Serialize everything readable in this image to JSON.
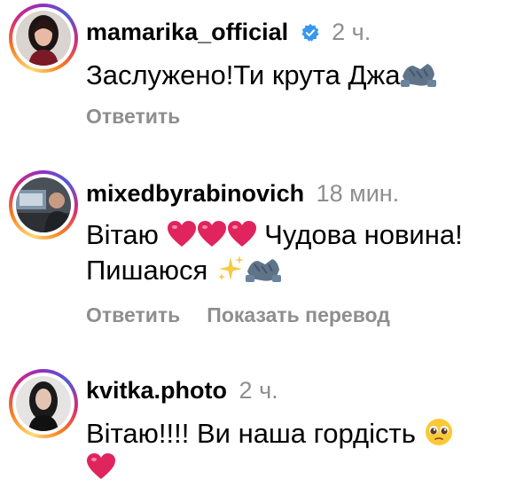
{
  "comments": [
    {
      "username": "mamarika_official",
      "verified": true,
      "time": "2 ч.",
      "text": "Заслужено!Ти крута Джа",
      "reply_label": "Ответить"
    },
    {
      "username": "mixedbyrabinovich",
      "verified": false,
      "time": "18 мин.",
      "text_part1": "Вітаю",
      "text_part2": "Чудова новина!",
      "text_line2": "Пишаюся",
      "reply_label": "Ответить",
      "translate_label": "Показать перевод"
    },
    {
      "username": "kvitka.photo",
      "verified": false,
      "time": "2 ч.",
      "text": "Вітаю!!!! Ви наша гордість"
    }
  ],
  "colors": {
    "text": "#000000",
    "muted": "#8e8e8e",
    "verified": "#3897f0",
    "heart": "#e0245e"
  },
  "icons": [
    "verified-badge-icon",
    "handshake-emoji-icon",
    "heart-emoji-icon",
    "sparkles-emoji-icon",
    "pleading-face-emoji-icon"
  ]
}
